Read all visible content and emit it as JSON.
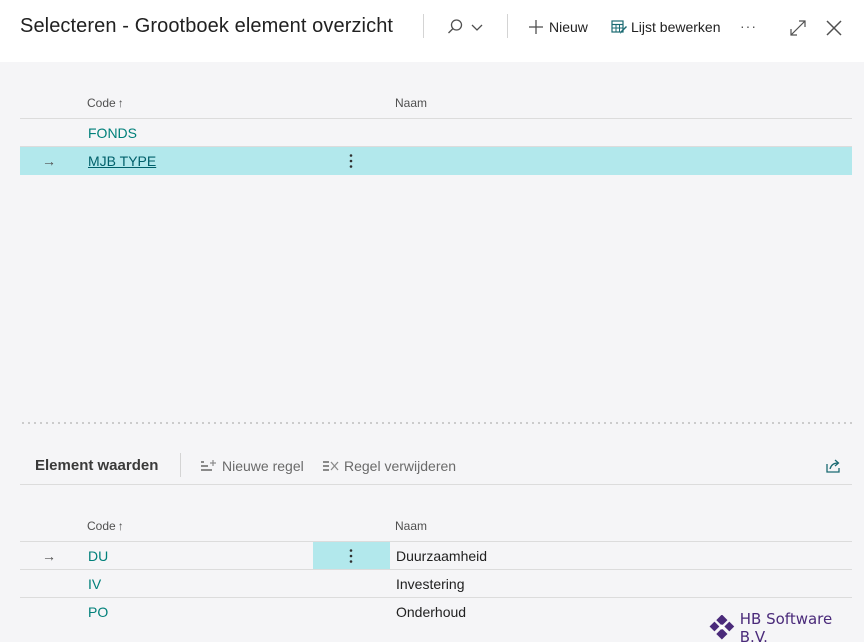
{
  "header": {
    "title": "Selecteren - Grootboek element overzicht",
    "new_label": "Nieuw",
    "edit_list_label": "Lijst bewerken",
    "more_label": "···"
  },
  "main_list": {
    "col_code": "Code",
    "sort_glyph": "↑",
    "col_name": "Naam",
    "rows": [
      {
        "code": "FONDS",
        "name": ""
      },
      {
        "code": "MJB TYPE",
        "name": "",
        "selected": true
      }
    ]
  },
  "subpart": {
    "title": "Element waarden",
    "new_line_label": "Nieuwe regel",
    "delete_line_label": "Regel verwijderen",
    "col_code": "Code",
    "sort_glyph": "↑",
    "col_name": "Naam",
    "rows": [
      {
        "code": "DU",
        "name": "Duurzaamheid",
        "selected": true
      },
      {
        "code": "IV",
        "name": "Investering"
      },
      {
        "code": "PO",
        "name": "Onderhoud"
      }
    ]
  },
  "row_arrow": "→",
  "logo": {
    "text": "HB Software B.V."
  },
  "colors": {
    "accent": "#00807a",
    "selected_row": "#b2e8ec",
    "logo": "#4a2a7a"
  },
  "icons": [
    "search-icon",
    "chevron-down-icon",
    "plus-icon",
    "edit-list-icon",
    "more-icon",
    "expand-icon",
    "close-icon",
    "kebab-icon",
    "new-line-icon",
    "delete-line-icon",
    "share-icon",
    "logo-icon"
  ]
}
